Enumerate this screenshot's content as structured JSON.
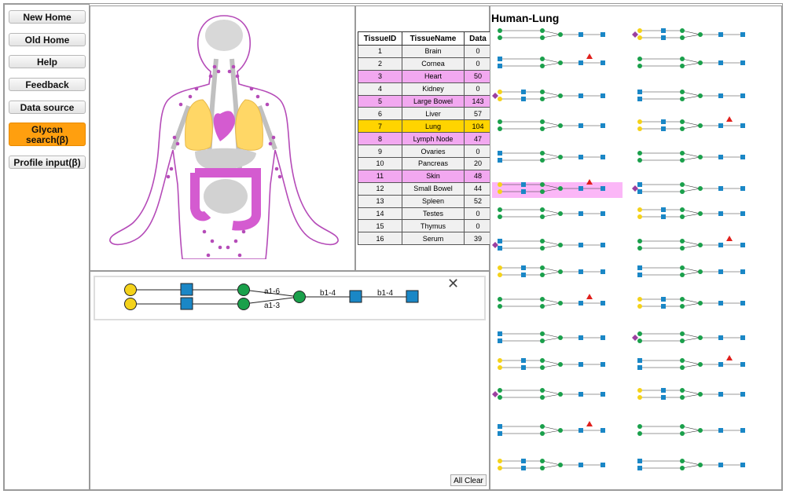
{
  "nav": {
    "new_home": "New Home",
    "old_home": "Old Home",
    "help": "Help",
    "feedback": "Feedback",
    "data_source": "Data source",
    "glycan_search_line1": "Glycan",
    "glycan_search_line2": "search(β)",
    "profile_input": "Profile input(β)"
  },
  "table": {
    "headers": [
      "TissueID",
      "TissueName",
      "Data"
    ],
    "rows": [
      {
        "id": "1",
        "name": "Brain",
        "data": "0",
        "state": "norm"
      },
      {
        "id": "2",
        "name": "Cornea",
        "data": "0",
        "state": "norm"
      },
      {
        "id": "3",
        "name": "Heart",
        "data": "50",
        "state": "pink"
      },
      {
        "id": "4",
        "name": "Kidney",
        "data": "0",
        "state": "norm"
      },
      {
        "id": "5",
        "name": "Large Bowel",
        "data": "143",
        "state": "pink"
      },
      {
        "id": "6",
        "name": "Liver",
        "data": "57",
        "state": "norm"
      },
      {
        "id": "7",
        "name": "Lung",
        "data": "104",
        "state": "sel"
      },
      {
        "id": "8",
        "name": "Lymph Node",
        "data": "47",
        "state": "pink"
      },
      {
        "id": "9",
        "name": "Ovaries",
        "data": "0",
        "state": "norm"
      },
      {
        "id": "10",
        "name": "Pancreas",
        "data": "20",
        "state": "norm"
      },
      {
        "id": "11",
        "name": "Skin",
        "data": "48",
        "state": "pink"
      },
      {
        "id": "12",
        "name": "Small Bowel",
        "data": "44",
        "state": "norm"
      },
      {
        "id": "13",
        "name": "Spleen",
        "data": "52",
        "state": "norm"
      },
      {
        "id": "14",
        "name": "Testes",
        "data": "0",
        "state": "norm"
      },
      {
        "id": "15",
        "name": "Thymus",
        "data": "0",
        "state": "norm"
      },
      {
        "id": "16",
        "name": "Serum",
        "data": "39",
        "state": "norm"
      }
    ]
  },
  "results_title": "Human-Lung",
  "query": {
    "link_a16": "a1-6",
    "link_a13": "a1-3",
    "link_b14_1": "b1-4",
    "link_b14_2": "b1-4"
  },
  "clear_label": "All Clear",
  "colors": {
    "galactose": "#f4d21a",
    "glcnac": "#1a87c6",
    "mannose": "#1aa04b",
    "fucose": "#e0201c",
    "sialic": "#9b3fa0",
    "highlight": "#fbb7f7",
    "active_button": "#ff9f0f"
  }
}
